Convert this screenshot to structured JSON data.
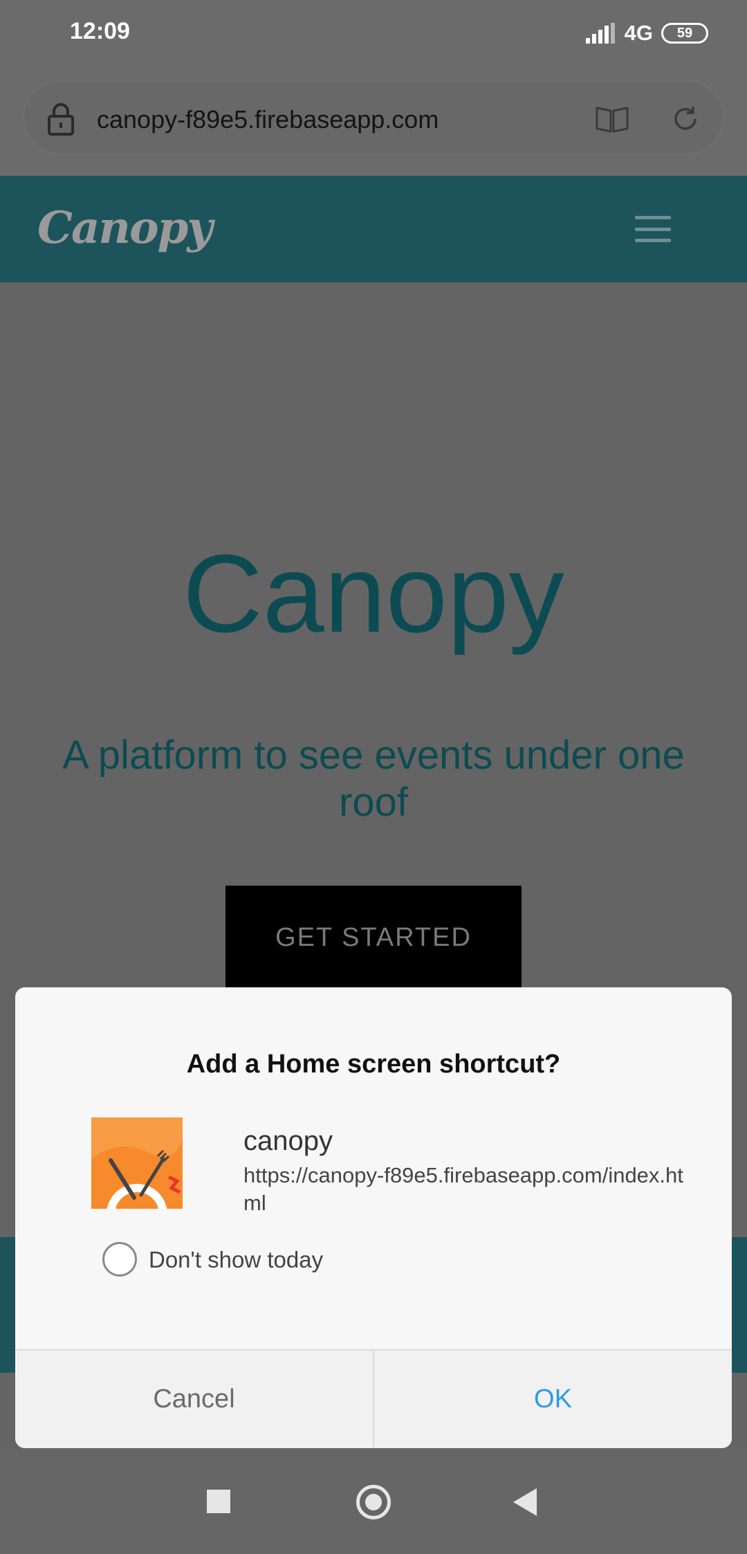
{
  "status_bar": {
    "time": "12:09",
    "network": "4G",
    "battery": "59"
  },
  "browser": {
    "url": "canopy-f89e5.firebaseapp.com"
  },
  "site": {
    "logo": "Canopy",
    "hero_title": "Canopy",
    "hero_subtitle": "A platform to see events under one roof",
    "cta_label": "GET STARTED"
  },
  "dialog": {
    "title": "Add a Home screen shortcut?",
    "app_name": "canopy",
    "app_url": "https://canopy-f89e5.firebaseapp.com/index.html",
    "checkbox_label": "Don't show today",
    "checkbox_checked": false,
    "cancel_label": "Cancel",
    "ok_label": "OK"
  },
  "colors": {
    "header_bg": "#1d545b",
    "hero_text": "#0d4b52",
    "ok_blue": "#2b9be4",
    "app_icon_orange": "#f68a2c"
  },
  "icons": [
    "lock-icon",
    "reader-mode-icon",
    "reload-icon",
    "menu-icon",
    "signal-icon",
    "battery-icon",
    "recents-icon",
    "home-icon",
    "back-icon"
  ]
}
